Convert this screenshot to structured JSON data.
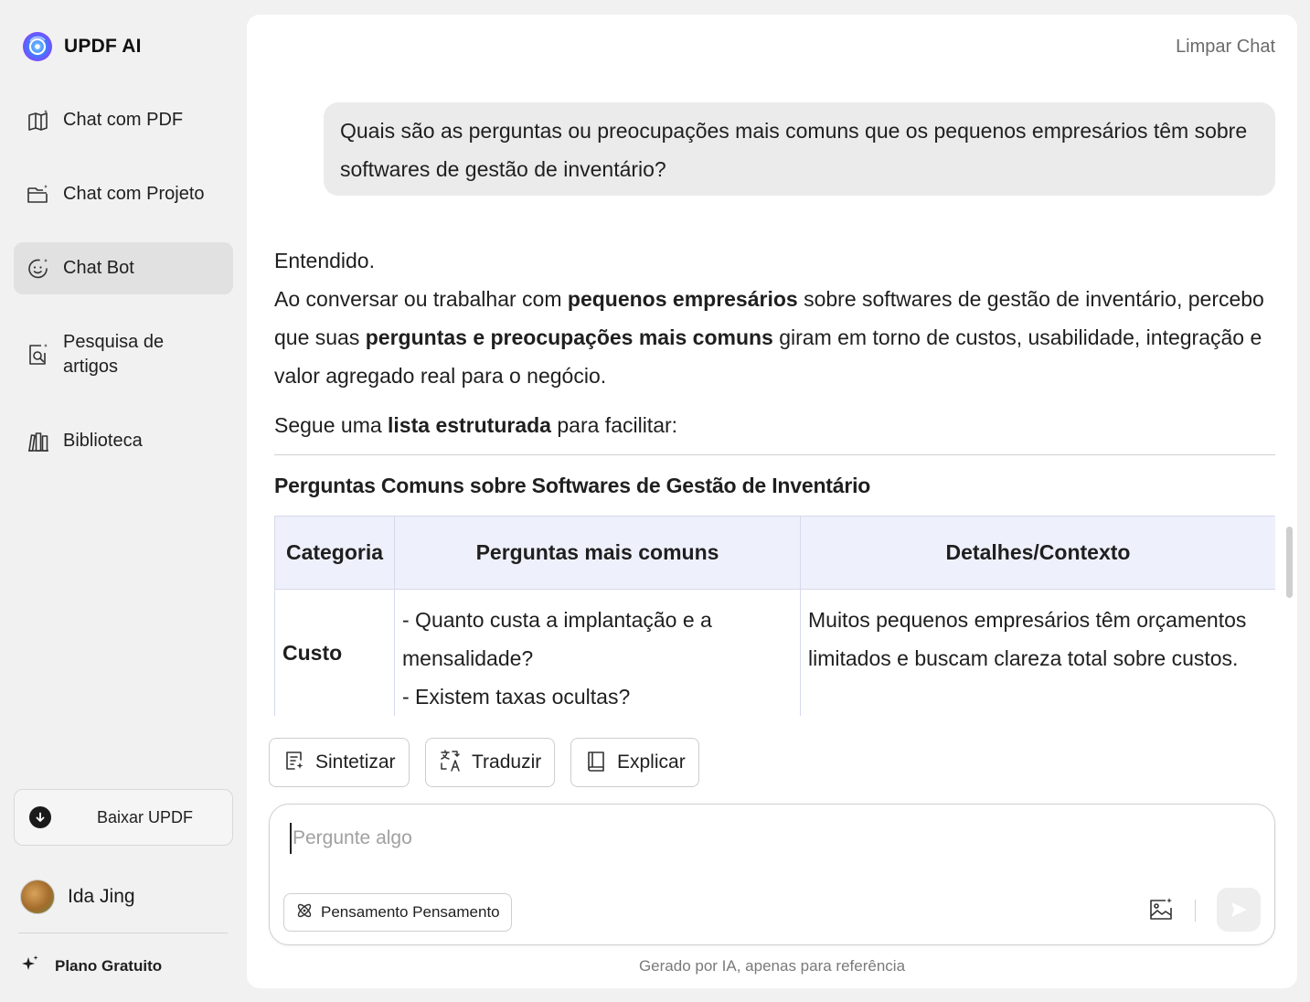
{
  "brand": {
    "name": "UPDF AI"
  },
  "sidebar": {
    "items": [
      {
        "label": "Chat com PDF"
      },
      {
        "label": "Chat com Projeto"
      },
      {
        "label": "Chat Bot"
      },
      {
        "label": "Pesquisa de artigos"
      },
      {
        "label": "Biblioteca"
      }
    ],
    "download_label": "Baixar UPDF",
    "user_name": "Ida Jing",
    "plan_label": "Plano Gratuito"
  },
  "header": {
    "clear_label": "Limpar Chat"
  },
  "chat": {
    "user_message": "Quais são as perguntas ou preocupações mais comuns que os pequenos empresários têm sobre softwares de gestão de inventário?",
    "answer": {
      "line1": "Entendido.",
      "p2_a": "Ao conversar ou trabalhar com ",
      "p2_b": "pequenos empresários",
      "p2_c": " sobre softwares de gestão de inventário, percebo que suas ",
      "p2_d": "perguntas e preocupações mais comuns",
      "p2_e": " giram em torno de custos, usabilidade, integração e valor agregado real para o negócio.",
      "p3_a": "Segue uma ",
      "p3_b": "lista estruturada",
      "p3_c": " para facilitar:"
    },
    "section_title": "Perguntas Comuns sobre Softwares de Gestão de Inventário",
    "table": {
      "headers": [
        "Categoria",
        "Perguntas mais comuns",
        "Detalhes/Contexto"
      ],
      "rows": [
        {
          "category": "Custo",
          "questions_1": "- Quanto custa a implantação e a mensalidade?",
          "questions_2": "- Existem taxas ocultas?",
          "details": "Muitos pequenos empresários têm orçamentos limitados e buscam clareza total sobre custos."
        }
      ]
    }
  },
  "actions": {
    "summarize": "Sintetizar",
    "translate": "Traduzir",
    "explain": "Explicar"
  },
  "input": {
    "placeholder": "Pergunte algo",
    "thinking_label": "Pensamento Pensamento"
  },
  "footer": {
    "disclaimer": "Gerado por IA, apenas para referência"
  }
}
